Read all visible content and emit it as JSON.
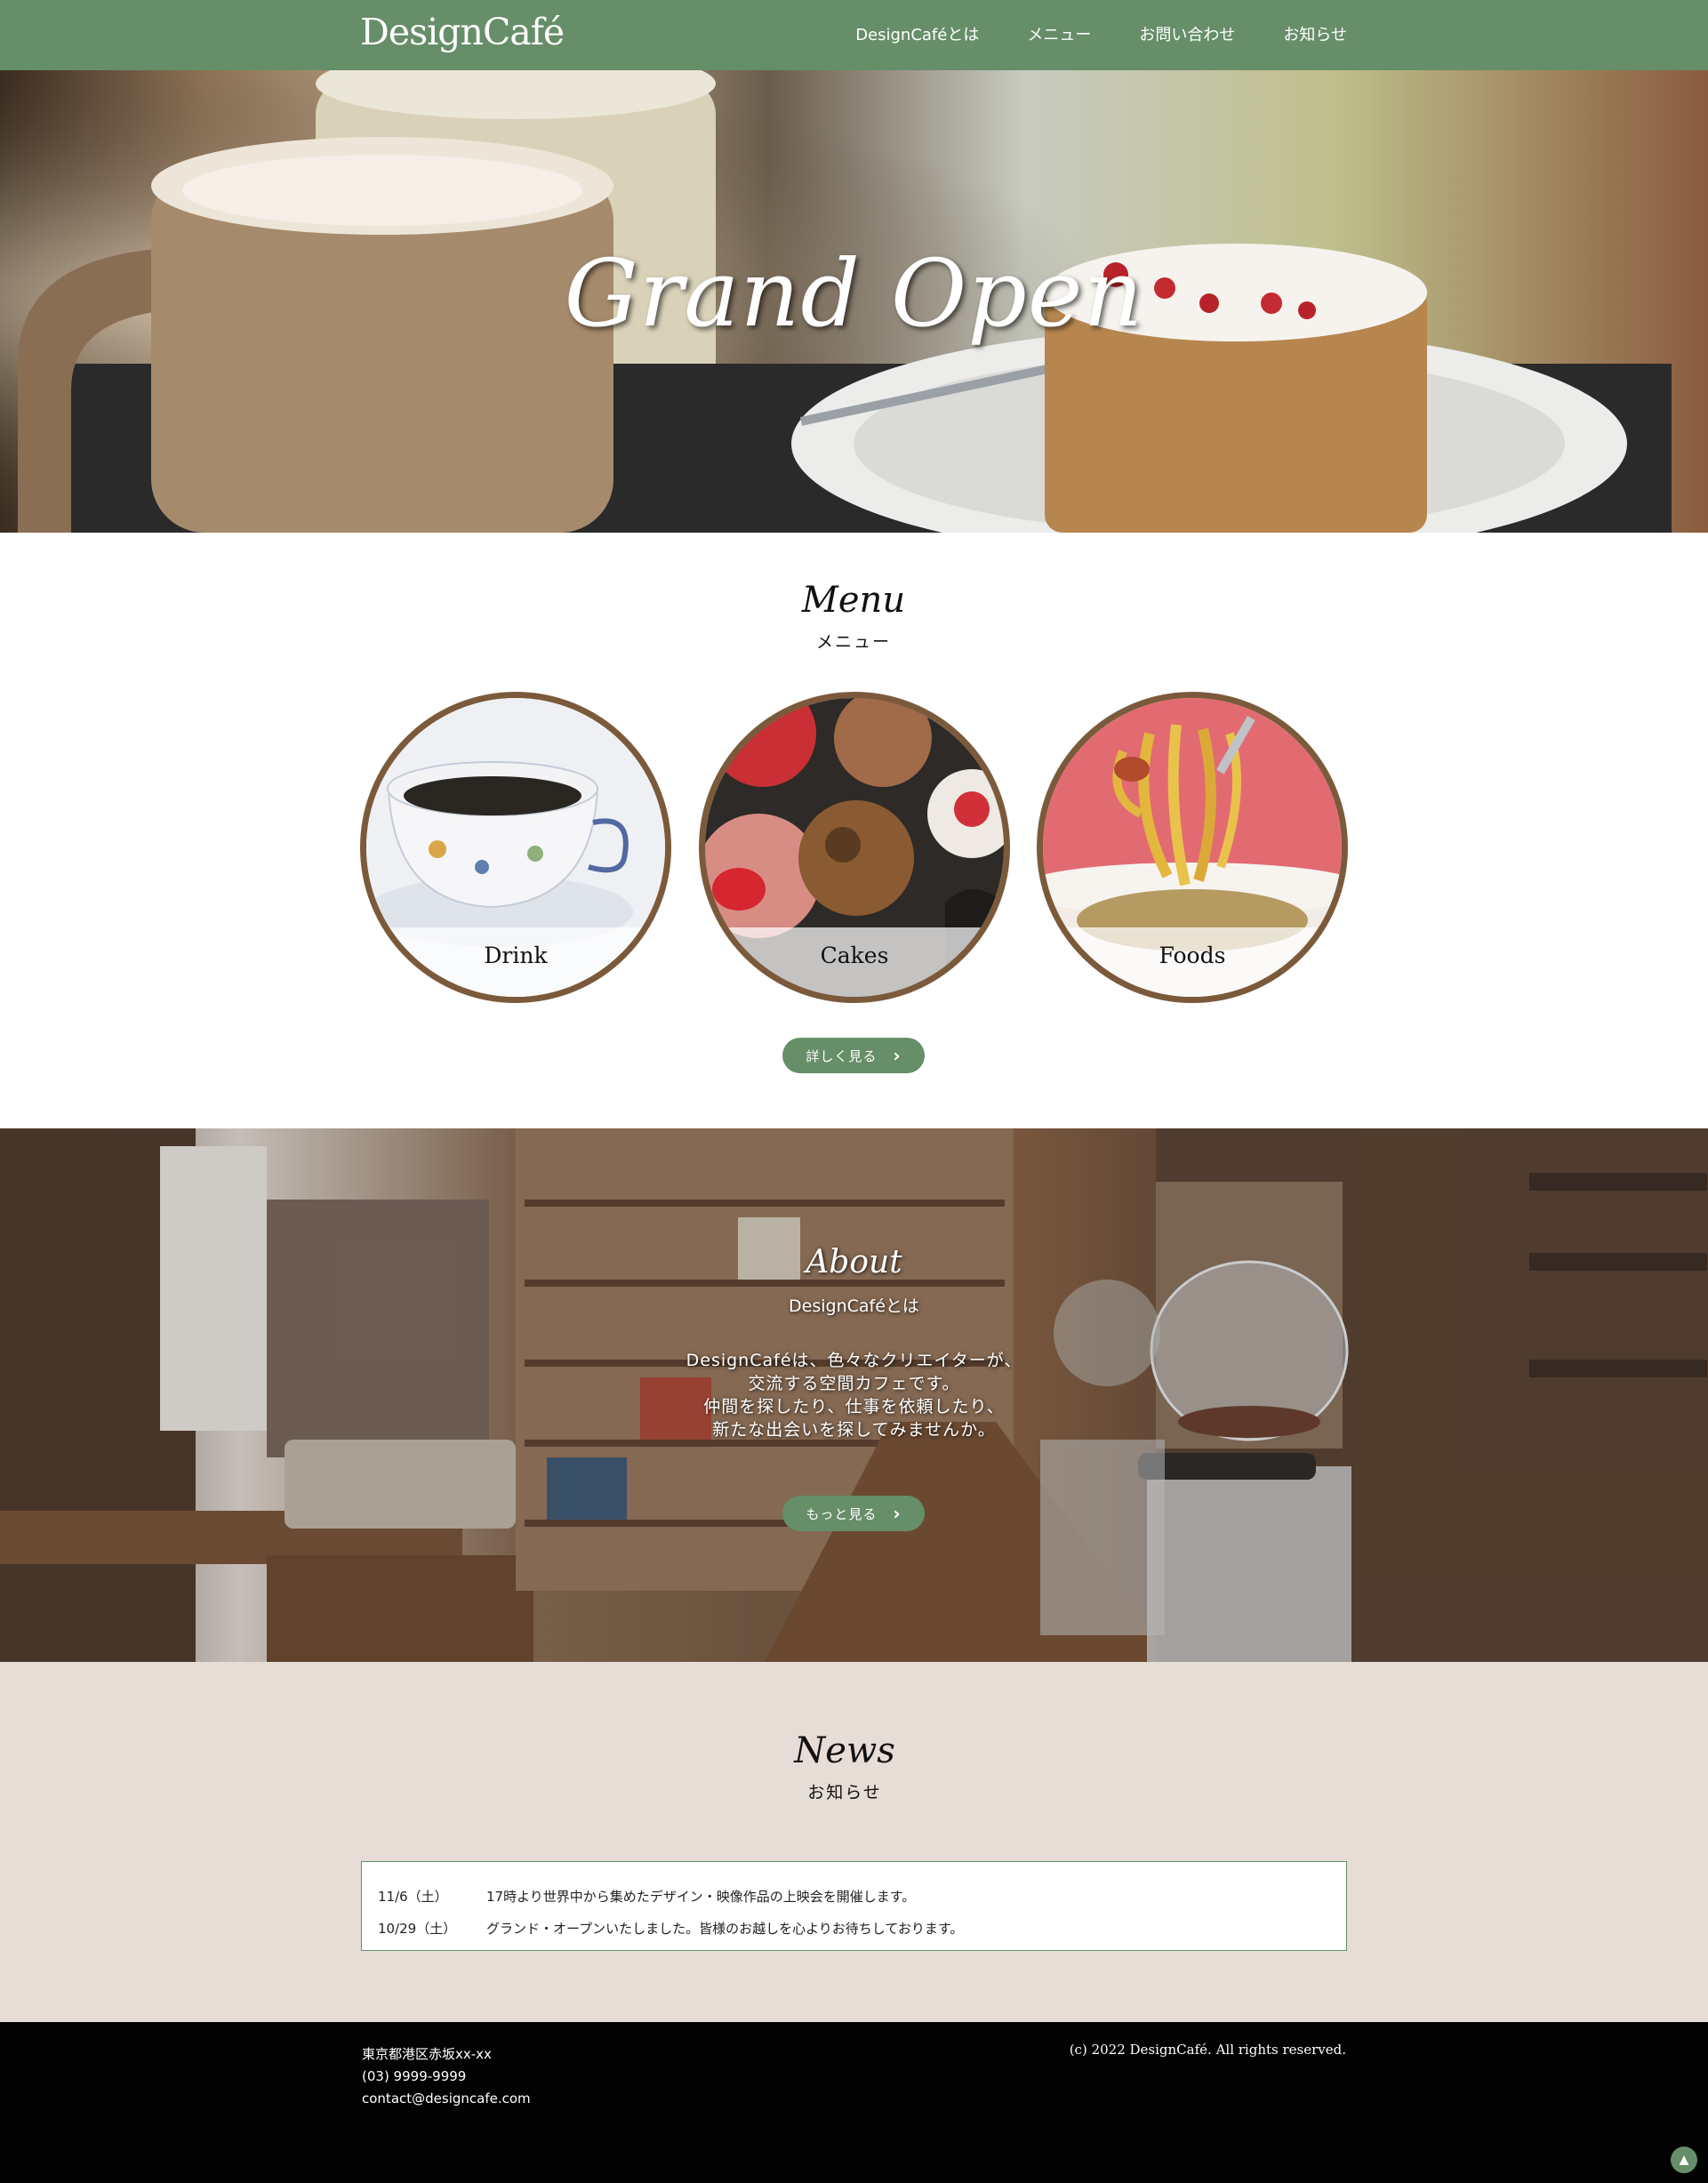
{
  "header": {
    "logo": "DesignCafé",
    "nav": [
      "DesignCaféとは",
      "メニュー",
      "お問い合わせ",
      "お知らせ"
    ]
  },
  "hero": {
    "title": "Grand Open"
  },
  "menu": {
    "title_en": "Menu",
    "title_ja": "メニュー",
    "items": [
      {
        "label": "Drink"
      },
      {
        "label": "Cakes"
      },
      {
        "label": "Foods"
      }
    ],
    "more_button": "詳しく見る"
  },
  "about": {
    "title_en": "About",
    "title_ja": "DesignCaféとは",
    "body": [
      "DesignCaféは、色々なクリエイターが、",
      "交流する空間カフェです。",
      "仲間を探したり、仕事を依頼したり、",
      "新たな出会いを探してみませんか。"
    ],
    "more_button": "もっと見る"
  },
  "news": {
    "title_en": "News",
    "title_ja": "お知らせ",
    "items": [
      {
        "date": "11/6（土）",
        "text": "17時より世界中から集めたデザイン・映像作品の上映会を開催します。"
      },
      {
        "date": "10/29（土）",
        "text": "グランド・オープンいたしました。皆様のお越しを心よりお待ちしております。"
      }
    ]
  },
  "footer": {
    "address": "東京都港区赤坂xx-xx",
    "phone": "(03) 9999-9999",
    "email": "contact@designcafe.com",
    "copyright": "(c) 2022 DesignCafé. All rights reserved."
  },
  "colors": {
    "brand_green": "#668e69",
    "circle_border": "#7b5a3b",
    "news_bg": "#e6ddd6",
    "footer_bg": "#020202"
  },
  "icons": {
    "chevron": "chevron-right-icon",
    "page_top": "arrow-up-icon"
  }
}
